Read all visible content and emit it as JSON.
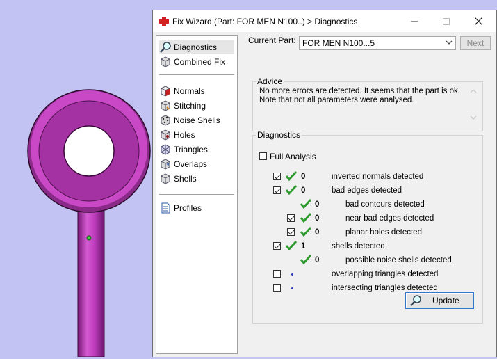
{
  "window": {
    "title": "Fix Wizard (Part: FOR MEN N100..) > Diagnostics"
  },
  "nav": [
    {
      "label": "Diagnostics",
      "icon": "magnifier-icon"
    },
    {
      "label": "Combined Fix",
      "icon": "cube-icon"
    },
    {
      "label": "Normals",
      "icon": "cube-icon"
    },
    {
      "label": "Stitching",
      "icon": "cube-icon"
    },
    {
      "label": "Noise Shells",
      "icon": "cube-icon"
    },
    {
      "label": "Holes",
      "icon": "cube-icon"
    },
    {
      "label": "Triangles",
      "icon": "cube-icon"
    },
    {
      "label": "Overlaps",
      "icon": "cube-icon"
    },
    {
      "label": "Shells",
      "icon": "cube-icon"
    },
    {
      "label": "Profiles",
      "icon": "document-icon"
    }
  ],
  "current_part": {
    "label": "Current Part:",
    "value": "FOR MEN N100...5",
    "next": "Next"
  },
  "advice": {
    "legend": "Advice",
    "line1": "No more errors are detected. It seems that the part is ok.",
    "line2": "Note that not all parameters were analysed."
  },
  "diagnostics": {
    "legend": "Diagnostics",
    "full_analysis": "Full Analysis",
    "rows": [
      {
        "count": "0",
        "label": "inverted normals detected"
      },
      {
        "count": "0",
        "label": "bad edges detected"
      },
      {
        "count": "0",
        "label": "bad contours detected"
      },
      {
        "count": "0",
        "label": "near bad edges detected"
      },
      {
        "count": "0",
        "label": "planar holes detected"
      },
      {
        "count": "1",
        "label": "shells detected"
      },
      {
        "count": "0",
        "label": "possible noise shells detected"
      },
      {
        "count": "",
        "label": "overlapping triangles detected"
      },
      {
        "count": "",
        "label": "intersecting triangles detected"
      }
    ],
    "update": "Update"
  },
  "colors": {
    "part": "#c23fc0",
    "background": "#c3c3f3",
    "tick": "#2e9a2e"
  }
}
